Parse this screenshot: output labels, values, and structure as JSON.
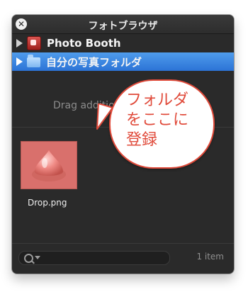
{
  "window": {
    "title": "フォトブラウザ",
    "close_symbol": "✕"
  },
  "sources": [
    {
      "label": "Photo Booth",
      "icon": "photo-booth-icon",
      "selected": false
    },
    {
      "label": "自分の写真フォルダ",
      "icon": "folder-icon",
      "selected": true
    }
  ],
  "drop_zone": {
    "hint": "Drag additio"
  },
  "items": [
    {
      "name": "Drop.png",
      "icon": "drop-image-icon"
    }
  ],
  "bottom_bar": {
    "item_count": "1 item"
  },
  "callout": {
    "text": "フォルダ\nをここに\n登録",
    "color": "#e04a3a"
  },
  "colors": {
    "selection": "#2c73d6",
    "window_bg": "#2a2a2a",
    "thumbnail_bg": "#d9706c"
  }
}
